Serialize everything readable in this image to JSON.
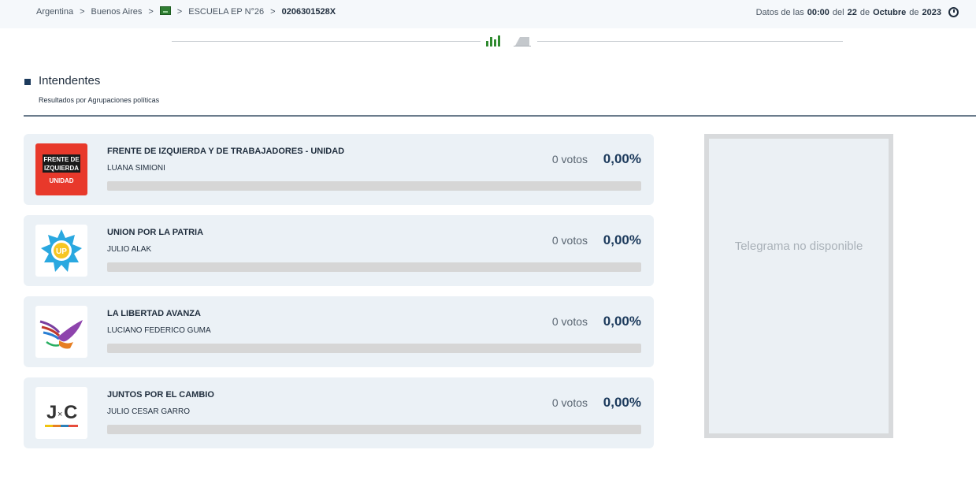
{
  "breadcrumb": {
    "items": [
      "Argentina",
      "Buenos Aires",
      "ESCUELA EP N°26",
      "0206301528X"
    ],
    "separator": ">"
  },
  "header": {
    "datetime_prefix": "Datos de las",
    "time": "00:00",
    "del": "del",
    "day": "22",
    "de1": "de",
    "month": "Octubre",
    "de2": "de",
    "year": "2023"
  },
  "section": {
    "title": "Intendentes",
    "subtitle": "Resultados por Agrupaciones políticas"
  },
  "results": [
    {
      "party": "FRENTE DE IZQUIERDA Y DE TRABAJADORES - UNIDAD",
      "candidate": "LUANA SIMIONI",
      "votes": "0 votos",
      "percent": "0,00%",
      "share": 0,
      "logo_text": [
        "FRENTE DE",
        "IZQUIERDA",
        "UNIDAD"
      ],
      "logo_icon": "fit-logo-icon"
    },
    {
      "party": "UNION POR LA PATRIA",
      "candidate": "JULIO ALAK",
      "votes": "0 votos",
      "percent": "0,00%",
      "share": 0,
      "logo_text": [
        "UP"
      ],
      "logo_icon": "up-sun-logo-icon"
    },
    {
      "party": "LA LIBERTAD AVANZA",
      "candidate": "LUCIANO FEDERICO GUMA",
      "votes": "0 votos",
      "percent": "0,00%",
      "share": 0,
      "logo_text": [],
      "logo_icon": "lla-eagle-logo-icon"
    },
    {
      "party": "JUNTOS POR EL CAMBIO",
      "candidate": "JULIO CESAR GARRO",
      "votes": "0 votos",
      "percent": "0,00%",
      "share": 0,
      "logo_text": [
        "J",
        "×",
        "C"
      ],
      "logo_icon": "jxc-logo-icon"
    }
  ],
  "telegram": {
    "message": "Telegrama no disponible"
  },
  "colors": {
    "accent": "#1c3a5c",
    "card_bg": "#ebf1f6",
    "bar_bg": "#d6d6d6",
    "chart_icon": "#2f8a2f"
  }
}
